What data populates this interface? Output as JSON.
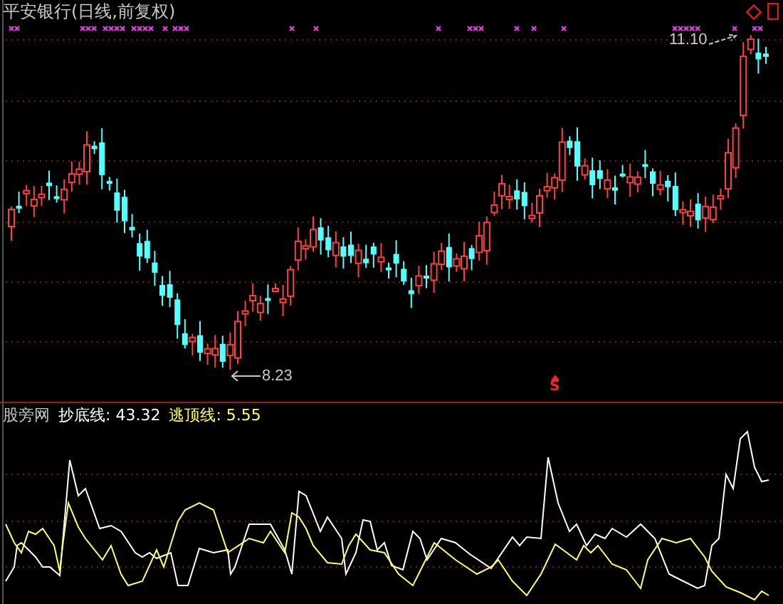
{
  "price_panel": {
    "title": "平安银行(日线,前复权)",
    "annotations": [
      {
        "kind": "high",
        "text": "11.10"
      },
      {
        "kind": "low",
        "text": "8.23"
      }
    ],
    "signal": "S"
  },
  "indicator_panel": {
    "legend": [
      {
        "kind": "name",
        "text": "股旁网"
      },
      {
        "kind": "value",
        "text": "抄底线: 43.32",
        "color": "#ffffff"
      },
      {
        "kind": "value",
        "text": "逃顶线: 5.55",
        "color": "#ffff66"
      }
    ]
  }
}
